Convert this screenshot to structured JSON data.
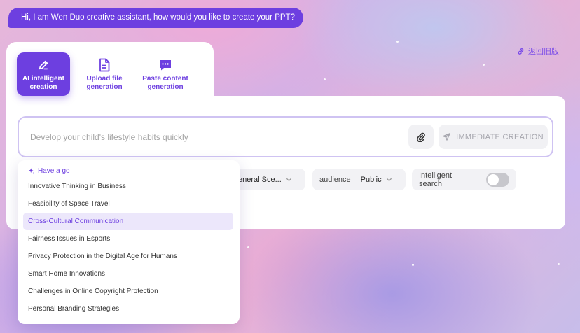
{
  "greeting": "Hi, I am Wen Duo creative assistant, how would you like to create your PPT?",
  "old_version_link": "返回旧版",
  "tabs": [
    {
      "label": "AI intelligent creation",
      "icon": "pen-icon",
      "active": true
    },
    {
      "label": "Upload file generation",
      "icon": "file-icon",
      "active": false
    },
    {
      "label": "Paste content generation",
      "icon": "chat-dots-icon",
      "active": false
    }
  ],
  "input": {
    "value": "",
    "placeholder": "Develop your child's lifestyle habits quickly"
  },
  "create_button": "IMMEDIATE CREATION",
  "options": {
    "scene_value": "eneral Sce...",
    "audience_label": "audience",
    "audience_value": "Public",
    "search_label": "Intelligent search",
    "search_enabled": false
  },
  "suggestions": {
    "heading": "Have a go",
    "items": [
      "Innovative Thinking in Business",
      "Feasibility of Space Travel",
      "Cross-Cultural Communication",
      "Fairness Issues in Esports",
      "Privacy Protection in the Digital Age for Humans",
      "Smart Home Innovations",
      "Challenges in Online Copyright Protection",
      "Personal Branding Strategies"
    ],
    "highlighted_index": 2
  },
  "colors": {
    "accent": "#6d3fe0",
    "highlight_bg": "#ece7fb",
    "toggle_off": "#c7c7cc"
  }
}
